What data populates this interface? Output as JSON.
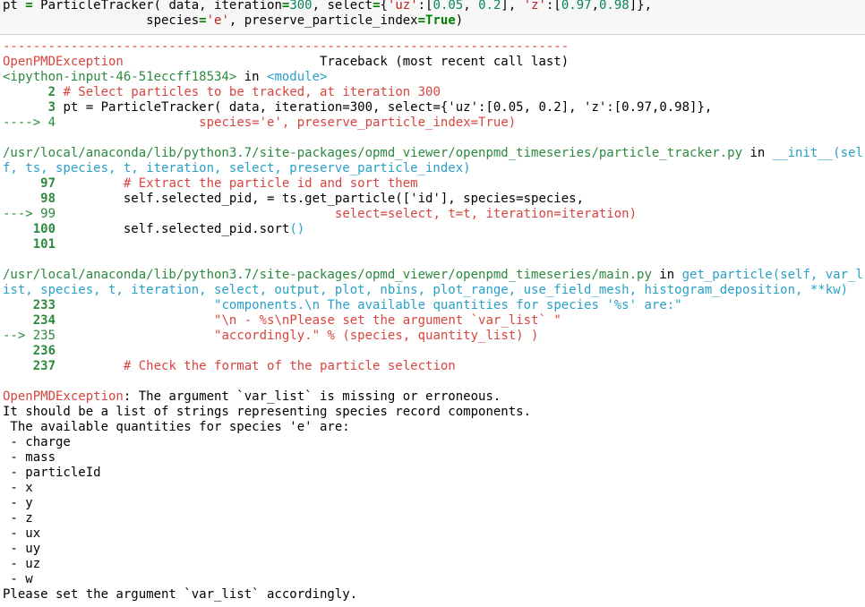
{
  "input": {
    "line1": [
      {
        "t": "pt "
      },
      {
        "t": "=",
        "c": "kw"
      },
      {
        "t": " ParticleTracker( data, iteration"
      },
      {
        "t": "=",
        "c": "kw"
      },
      {
        "t": "300",
        "c": "num"
      },
      {
        "t": ", select"
      },
      {
        "t": "=",
        "c": "kw"
      },
      {
        "t": "{"
      },
      {
        "t": "'uz'",
        "c": "str"
      },
      {
        "t": ":["
      },
      {
        "t": "0.05",
        "c": "num"
      },
      {
        "t": ", "
      },
      {
        "t": "0.2",
        "c": "num"
      },
      {
        "t": "], "
      },
      {
        "t": "'z'",
        "c": "str"
      },
      {
        "t": ":["
      },
      {
        "t": "0.97",
        "c": "num"
      },
      {
        "t": ","
      },
      {
        "t": "0.98",
        "c": "num"
      },
      {
        "t": "]},"
      }
    ],
    "line2": [
      {
        "t": "                   species"
      },
      {
        "t": "=",
        "c": "kw"
      },
      {
        "t": "'e'",
        "c": "str"
      },
      {
        "t": ", preserve_particle_index"
      },
      {
        "t": "=",
        "c": "kw"
      },
      {
        "t": "True",
        "c": "kw"
      },
      {
        "t": ")"
      }
    ]
  },
  "output_lines": [
    [
      {
        "t": "---------------------------------------------------------------------------",
        "c": "r"
      }
    ],
    [
      {
        "t": "OpenPMDException",
        "c": "r"
      },
      {
        "t": "                          Traceback (most recent call last)"
      }
    ],
    [
      {
        "t": "<ipython-input-46-51eccff18534>",
        "c": "g"
      },
      {
        "t": " in "
      },
      {
        "t": "<module>",
        "c": "c"
      }
    ],
    [
      {
        "t": "      "
      },
      {
        "t": "2",
        "c": "gb"
      },
      {
        "t": " "
      },
      {
        "t": "# Select particles to be tracked, at iteration 300",
        "c": "r"
      }
    ],
    [
      {
        "t": "      "
      },
      {
        "t": "3",
        "c": "gb"
      },
      {
        "t": " pt = ParticleTracker( data, iteration=300, select={'uz':[0.05, 0.2], 'z':[0.97,0.98]},"
      }
    ],
    [
      {
        "t": "----> 4",
        "c": "g"
      },
      {
        "t": "                   "
      },
      {
        "t": "species='e', preserve_particle_index=True)",
        "c": "r"
      }
    ],
    [
      {
        "t": ""
      }
    ],
    [
      {
        "t": "/usr/local/anaconda/lib/python3.7/site-packages/opmd_viewer/openpmd_timeseries/particle_tracker.py",
        "c": "g"
      },
      {
        "t": " in "
      },
      {
        "t": "__init__",
        "c": "c"
      },
      {
        "t": "(sel",
        "c": "c"
      }
    ],
    [
      {
        "t": "f, ts, species, t, iteration, select, preserve_particle_index)",
        "c": "c"
      }
    ],
    [
      {
        "t": "     "
      },
      {
        "t": "97",
        "c": "gb"
      },
      {
        "t": "         "
      },
      {
        "t": "# Extract the particle id and sort them",
        "c": "r"
      }
    ],
    [
      {
        "t": "     "
      },
      {
        "t": "98",
        "c": "gb"
      },
      {
        "t": "         self.selected_pid, = ts.get_particle(['id'], species=species,"
      }
    ],
    [
      {
        "t": "---> 99",
        "c": "g"
      },
      {
        "t": "                                     "
      },
      {
        "t": "select=select, t=t, iteration=iteration)",
        "c": "r"
      }
    ],
    [
      {
        "t": "    "
      },
      {
        "t": "100",
        "c": "gb"
      },
      {
        "t": "         self.selected_pid.sort"
      },
      {
        "t": "()",
        "c": "c"
      }
    ],
    [
      {
        "t": "    "
      },
      {
        "t": "101",
        "c": "gb"
      }
    ],
    [
      {
        "t": ""
      }
    ],
    [
      {
        "t": "/usr/local/anaconda/lib/python3.7/site-packages/opmd_viewer/openpmd_timeseries/main.py",
        "c": "g"
      },
      {
        "t": " in "
      },
      {
        "t": "get_particle(self, var_l",
        "c": "c"
      }
    ],
    [
      {
        "t": "ist, species, t, iteration, select, output, plot, nbins, plot_range, use_field_mesh, histogram_deposition, **kw)",
        "c": "c"
      }
    ],
    [
      {
        "t": "    "
      },
      {
        "t": "233",
        "c": "gb"
      },
      {
        "t": "                     "
      },
      {
        "t": "\"components.\\n The available quantities for species '%s' are:\"",
        "c": "c"
      }
    ],
    [
      {
        "t": "    "
      },
      {
        "t": "234",
        "c": "gb"
      },
      {
        "t": "                     "
      },
      {
        "t": "\"\\n - %s\\nPlease set the argument `var_list` \"",
        "c": "r"
      }
    ],
    [
      {
        "t": "--> 235",
        "c": "g"
      },
      {
        "t": "                     "
      },
      {
        "t": "\"accordingly.\" % (species, quantity_list) )",
        "c": "r"
      }
    ],
    [
      {
        "t": "    "
      },
      {
        "t": "236",
        "c": "gb"
      }
    ],
    [
      {
        "t": "    "
      },
      {
        "t": "237",
        "c": "gb"
      },
      {
        "t": "         "
      },
      {
        "t": "# Check the format of the particle selection",
        "c": "r"
      }
    ],
    [
      {
        "t": ""
      }
    ],
    [
      {
        "t": "OpenPMDException",
        "c": "r"
      },
      {
        "t": ": The argument `var_list` is missing or erroneous."
      }
    ],
    [
      {
        "t": "It should be a list of strings representing species record components."
      }
    ],
    [
      {
        "t": " The available quantities for species 'e' are:"
      }
    ],
    [
      {
        "t": " - charge"
      }
    ],
    [
      {
        "t": " - mass"
      }
    ],
    [
      {
        "t": " - particleId"
      }
    ],
    [
      {
        "t": " - x"
      }
    ],
    [
      {
        "t": " - y"
      }
    ],
    [
      {
        "t": " - z"
      }
    ],
    [
      {
        "t": " - ux"
      }
    ],
    [
      {
        "t": " - uy"
      }
    ],
    [
      {
        "t": " - uz"
      }
    ],
    [
      {
        "t": " - w"
      }
    ],
    [
      {
        "t": "Please set the argument `var_list` accordingly."
      }
    ]
  ]
}
